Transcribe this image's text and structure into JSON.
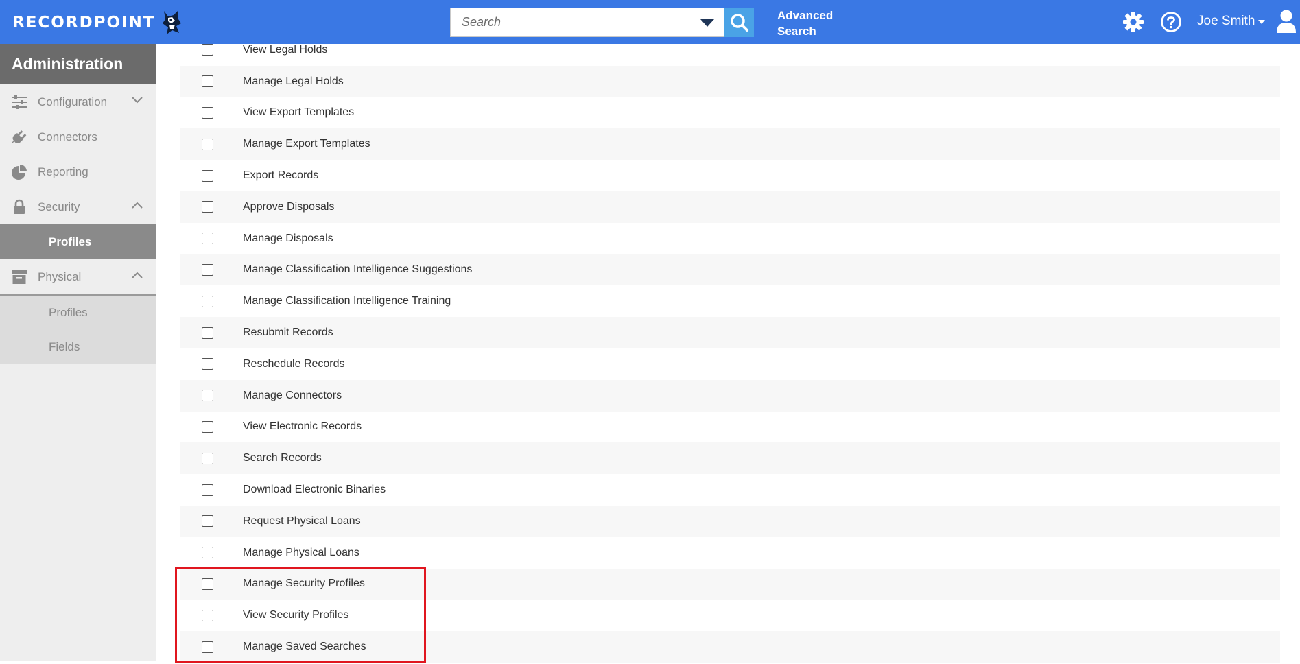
{
  "header": {
    "logo_text": "RECORDPOINT",
    "search_placeholder": "Search",
    "advanced_search_line1": "Advanced",
    "advanced_search_line2": "Search",
    "user_name": "Joe Smith",
    "bg_color": "#3a78e4"
  },
  "sidebar": {
    "title": "Administration",
    "items": [
      {
        "label": "Configuration",
        "icon": "sliders-icon"
      },
      {
        "label": "Connectors",
        "icon": "plug-icon"
      },
      {
        "label": "Reporting",
        "icon": "pie-chart-icon"
      },
      {
        "label": "Security",
        "icon": "lock-icon"
      },
      {
        "label": "Profiles"
      },
      {
        "label": "Physical",
        "icon": "archive-box-icon"
      },
      {
        "label": "Profiles"
      },
      {
        "label": "Fields"
      }
    ]
  },
  "permissions": [
    "View Legal Holds",
    "Manage Legal Holds",
    "View Export Templates",
    "Manage Export Templates",
    "Export Records",
    "Approve Disposals",
    "Manage Disposals",
    "Manage Classification Intelligence Suggestions",
    "Manage Classification Intelligence Training",
    "Resubmit Records",
    "Reschedule Records",
    "Manage Connectors",
    "View Electronic Records",
    "Search Records",
    "Download Electronic Binaries",
    "Request Physical Loans",
    "Manage Physical Loans",
    "Manage Security Profiles",
    "View Security Profiles",
    "Manage Saved Searches"
  ],
  "highlight_color": "#e0161f"
}
